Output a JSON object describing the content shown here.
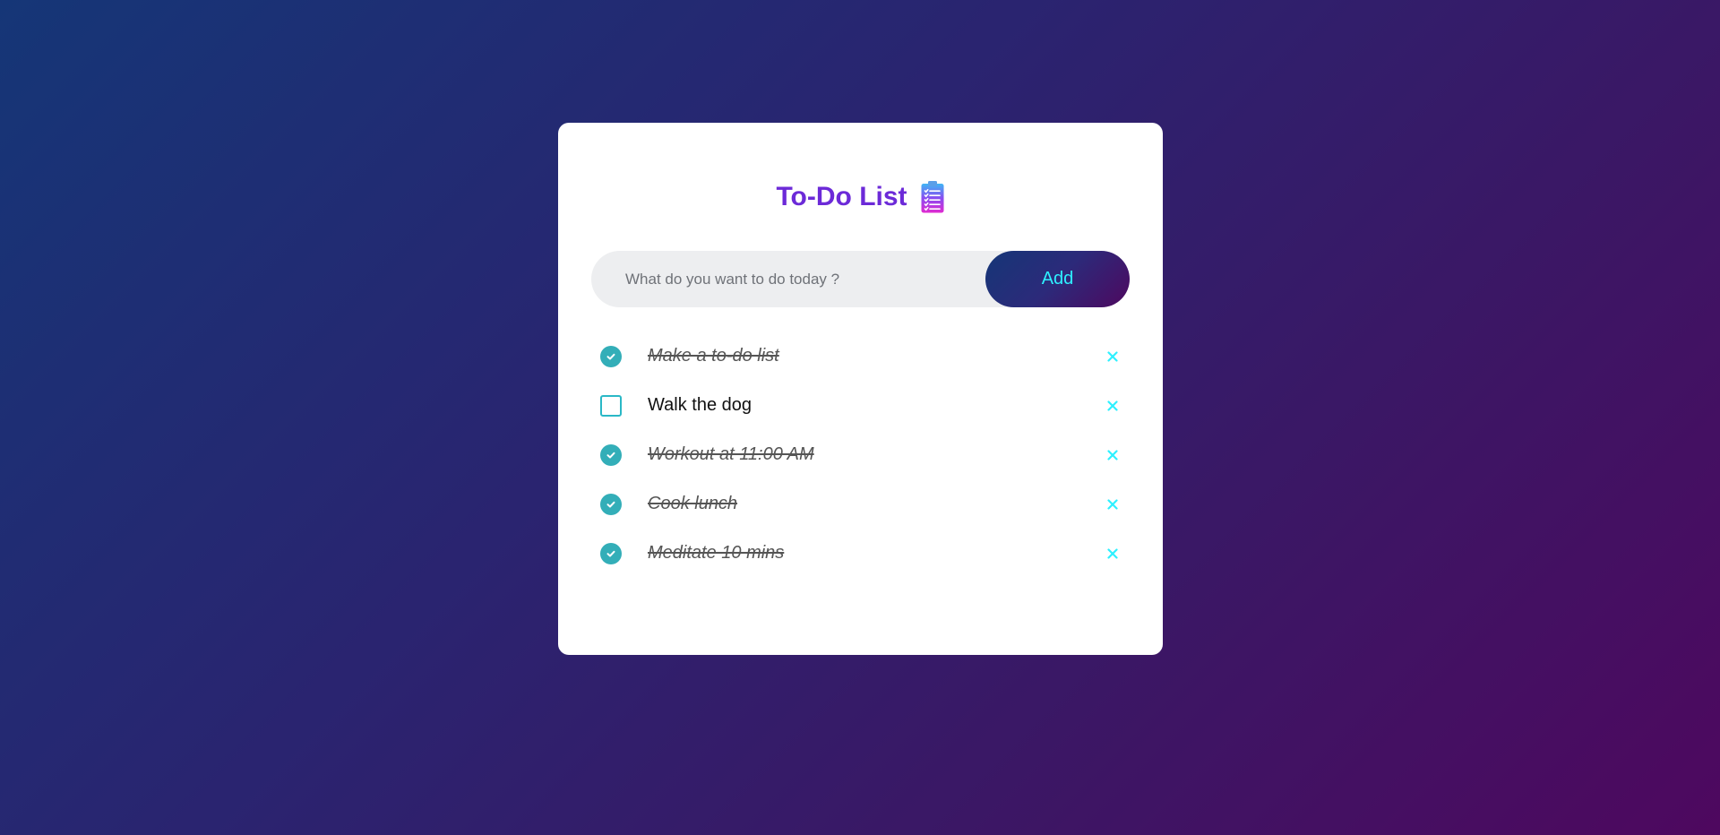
{
  "app": {
    "title": "To-Do List",
    "title_icon": "clipboard-icon"
  },
  "input": {
    "value": "",
    "placeholder": "What do you want to do today ?"
  },
  "add_button": {
    "label": "Add"
  },
  "colors": {
    "title": "#6c2ad8",
    "accent": "#2ef0ff",
    "check": "#33aeb8",
    "gradient_start": "#153677",
    "gradient_end": "#4e085f"
  },
  "todos": [
    {
      "text": "Make a to-do list",
      "completed": true,
      "check_icon": "check-circle-icon",
      "delete_icon": "close-icon"
    },
    {
      "text": "Walk the dog",
      "completed": false,
      "check_icon": "empty-checkbox-icon",
      "delete_icon": "close-icon"
    },
    {
      "text": "Workout at 11:00 AM",
      "completed": true,
      "check_icon": "check-circle-icon",
      "delete_icon": "close-icon"
    },
    {
      "text": "Cook lunch",
      "completed": true,
      "check_icon": "check-circle-icon",
      "delete_icon": "close-icon"
    },
    {
      "text": "Meditate 10 mins",
      "completed": true,
      "check_icon": "check-circle-icon",
      "delete_icon": "close-icon"
    }
  ]
}
